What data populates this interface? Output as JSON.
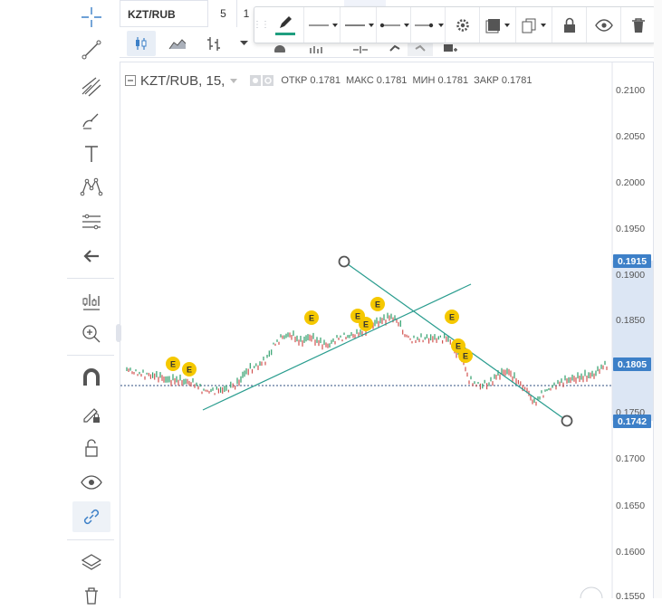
{
  "symbol_box": "KZT/RUB",
  "top_toolbar": {
    "timeframe_a": "5",
    "timeframe_b": "1"
  },
  "legend": {
    "symbol": "KZT/RUB, 15,",
    "open_label": "ОТКР",
    "open": "0.1781",
    "high_label": "МАКС",
    "high": "0.1781",
    "low_label": "МИН",
    "low": "0.1781",
    "close_label": "ЗАКР",
    "close": "0.1781"
  },
  "price_axis": {
    "ticks": [
      "0.2100",
      "0.2050",
      "0.2000",
      "0.1950",
      "0.1900",
      "0.1850",
      "0.1750",
      "0.1700",
      "0.1650",
      "0.1600",
      "0.1550"
    ],
    "badges": [
      {
        "value": "0.1915",
        "kind": "line-start"
      },
      {
        "value": "0.1805",
        "kind": "last-price"
      },
      {
        "value": "0.1742",
        "kind": "line-end"
      }
    ]
  },
  "earnings_marker_label": "E",
  "colors": {
    "accent": "#3d80c8",
    "trendline": "#2a9d8f",
    "candle_up": "#2e9e6b",
    "candle_down": "#d2524f",
    "event": "#f5c800",
    "pencil_underline": "#1f9e7f"
  },
  "icons": {
    "left_toolbar": [
      "crosshair-icon",
      "trend-line-icon",
      "pitchfork-icon",
      "brush-icon",
      "text-icon",
      "pattern-icon",
      "fib-icon",
      "arrow-left-icon",
      "ruler-icon",
      "zoom-in-icon",
      "magnet-icon",
      "lock-drawing-icon",
      "unlock-icon",
      "eye-icon",
      "link-icon",
      "layers-icon",
      "trash-icon"
    ],
    "drawing_toolbar": [
      "pencil-icon",
      "line-style-icon",
      "line-width-icon",
      "line-start-icon",
      "line-end-icon",
      "settings-icon",
      "fill-icon",
      "clone-icon",
      "lock-icon",
      "visibility-icon",
      "delete-icon"
    ]
  }
}
